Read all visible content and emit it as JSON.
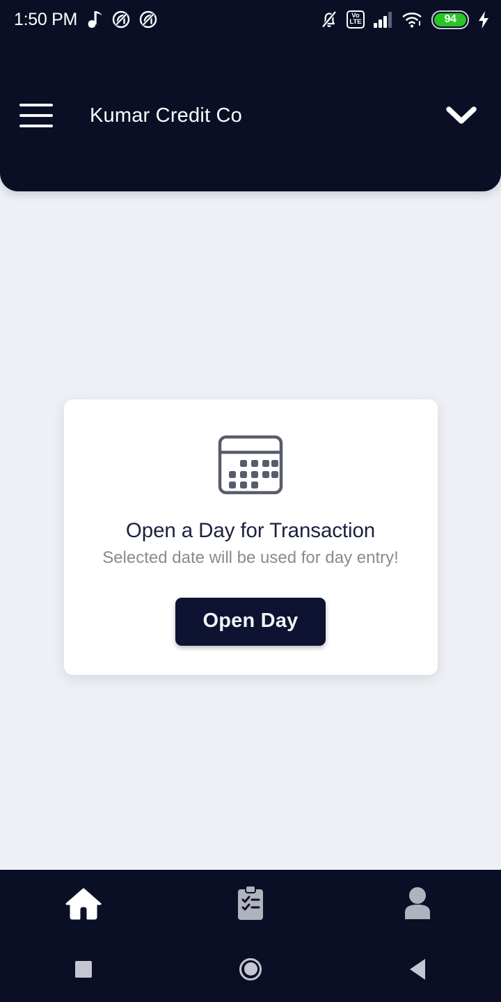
{
  "status_bar": {
    "time": "1:50 PM",
    "left_icons": [
      "music-note-icon",
      "app-badge-icon",
      "app-badge-icon"
    ],
    "right_icons": [
      "bell-off-icon",
      "volte-icon",
      "signal-bars-icon",
      "wifi-icon",
      "battery-icon",
      "charging-bolt-icon"
    ],
    "volte_top": "Vo",
    "volte_bottom": "LTE",
    "battery_percent": "94",
    "battery_color": "#28c624"
  },
  "header": {
    "title": "Kumar Credit Co",
    "menu_icon": "hamburger-menu-icon",
    "dropdown_icon": "chevron-down-icon",
    "background_color": "#0a0f26"
  },
  "card": {
    "icon": "calendar-icon",
    "title": "Open a Day for Transaction",
    "subtitle": "Selected date will be used for day entry!",
    "button_label": "Open Day",
    "button_color": "#0d1330"
  },
  "bottom_nav": {
    "items": [
      {
        "name": "home",
        "icon": "home-icon",
        "active": true
      },
      {
        "name": "transactions",
        "icon": "clipboard-checklist-icon",
        "active": false
      },
      {
        "name": "profile",
        "icon": "person-icon",
        "active": false
      }
    ],
    "active_color": "#ffffff",
    "inactive_color": "#b0b3bd"
  },
  "system_nav": {
    "recents": "square-recents-icon",
    "home": "circle-home-icon",
    "back": "triangle-back-icon"
  },
  "theme": {
    "background": "#eef0f5",
    "dark_navy": "#0a0f26",
    "card_background": "#ffffff"
  }
}
